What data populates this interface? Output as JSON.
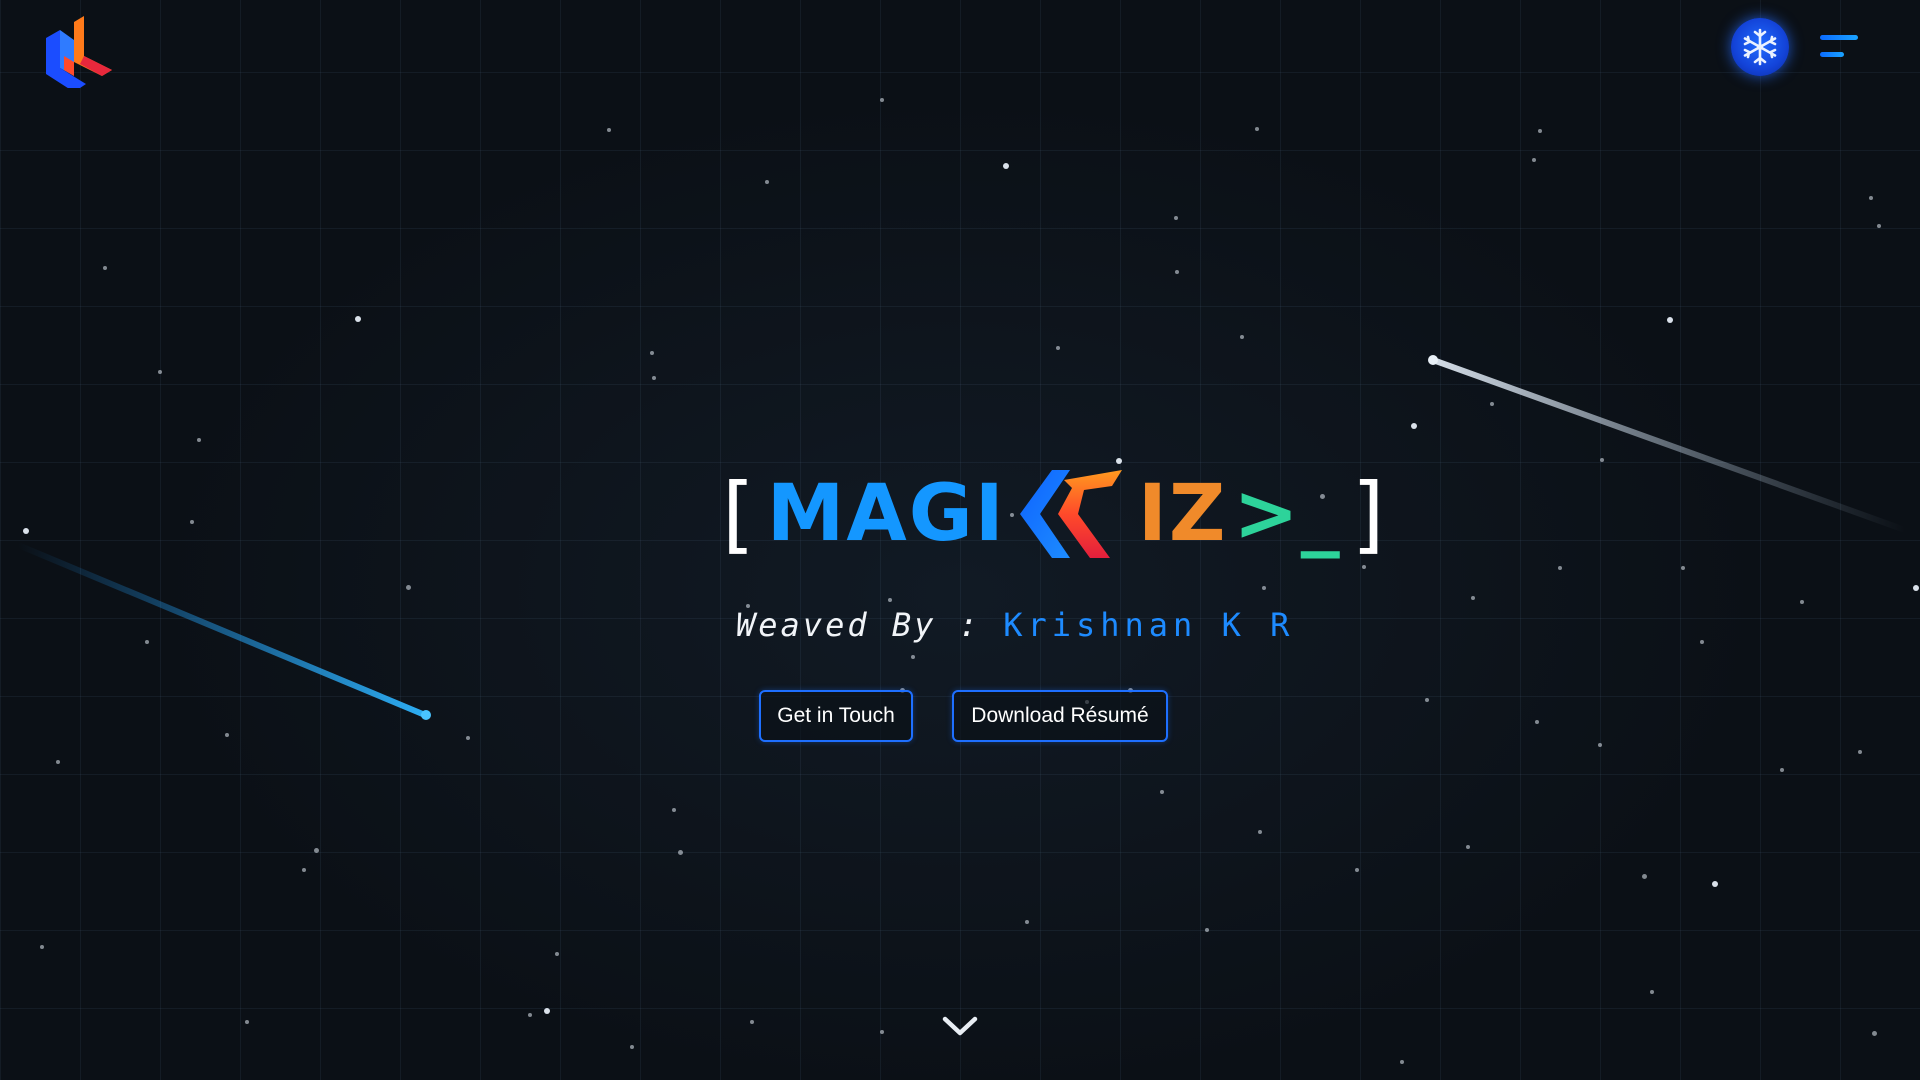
{
  "header": {
    "logo_icon": "brand-logo-icon",
    "theme_toggle_icon": "snowflake-icon",
    "menu_icon": "hamburger-menu-icon"
  },
  "hero": {
    "title": {
      "open_bracket": "[",
      "part1": "MAGI",
      "part2": "IZ",
      "caret": ">",
      "underscore": "_",
      "close_bracket": "]"
    },
    "byline_prefix": "Weaved By : ",
    "byline_name": "Krishnan K R"
  },
  "actions": {
    "contact_label": "Get in Touch",
    "resume_label": "Download Résumé"
  },
  "scroll_icon": "chevron-down-icon",
  "colors": {
    "background": "#0b1016",
    "accent_blue": "#1497ff",
    "accent_orange": "#f08a2a",
    "accent_red": "#e8283c",
    "accent_green": "#2dd39a",
    "button_border": "#1e6fff"
  }
}
